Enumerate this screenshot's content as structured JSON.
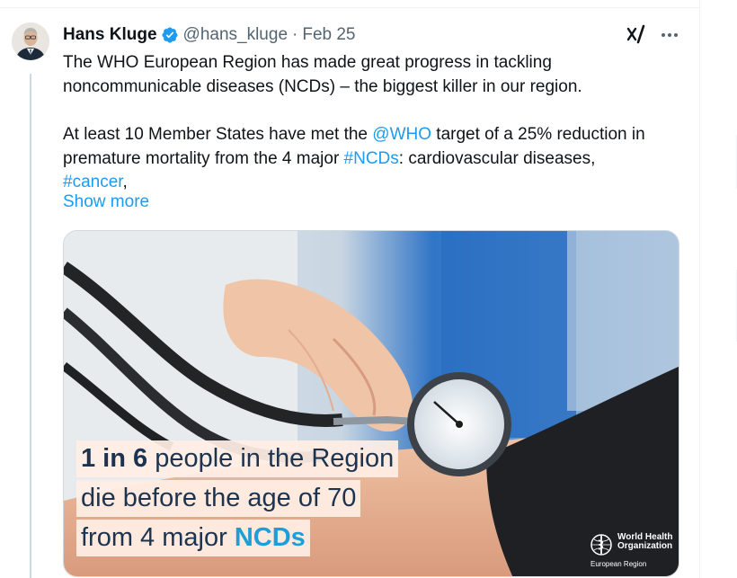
{
  "post": {
    "author_name": "Hans Kluge",
    "handle": "@hans_kluge",
    "separator": "·",
    "date": "Feb 25",
    "text": {
      "p1": "The WHO European Region has made great progress in tackling noncommunicable diseases (NCDs) – the biggest killer in our region.",
      "p2_a": "At least 10 Member States have met the ",
      "p2_mention": "@WHO",
      "p2_b": " target of a 25% reduction in premature mortality from the 4 major ",
      "p2_tag_ncds": "#NCDs",
      "p2_c": ": cardiovascular diseases, ",
      "p2_tag_cancer": "#cancer",
      "p2_d": ","
    },
    "show_more_label": "Show more"
  },
  "media": {
    "caption": {
      "line1_bold": "1 in 6",
      "line1_rest": " people in the Region",
      "line2": "die before the age of 70",
      "line3_plain": "from 4 major ",
      "line3_blue": "NCDs"
    },
    "logo": {
      "name_line1": "World Health",
      "name_line2": "Organization",
      "sub": "European Region"
    }
  },
  "icons": {
    "verified": "verified-badge-icon",
    "grok": "grok-icon",
    "more": "more-options-icon"
  },
  "colors": {
    "link": "#1d9bf0",
    "text": "#0f1419",
    "secondary": "#536471",
    "caption_text": "#1c3450",
    "caption_highlight": "#1c9ed8"
  }
}
